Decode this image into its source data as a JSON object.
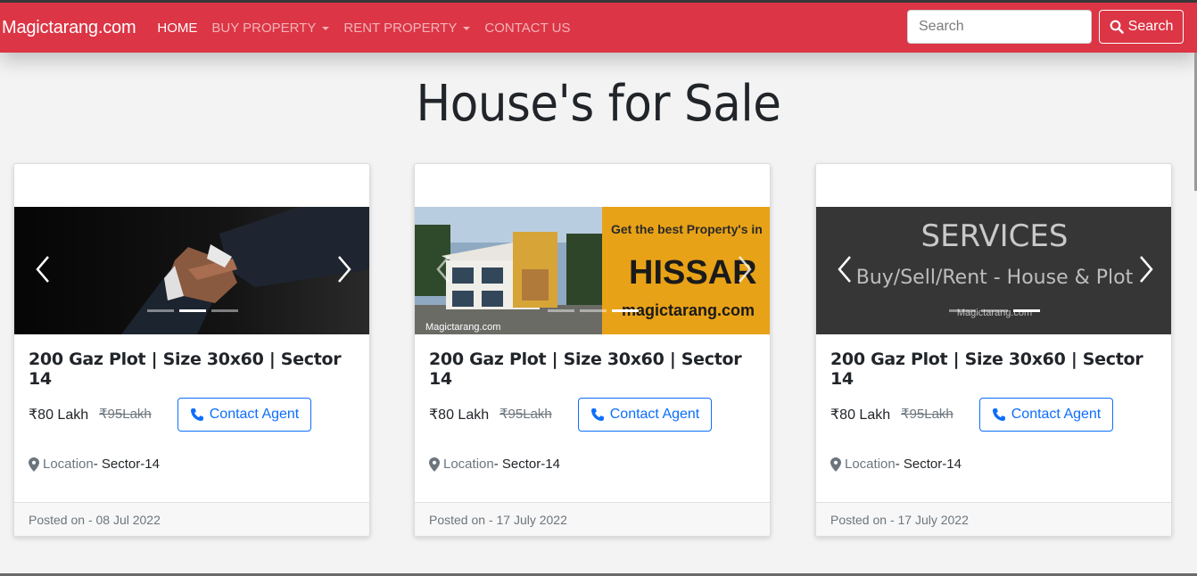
{
  "brand": "Magictarang.com",
  "nav": {
    "home": "HOME",
    "buy": "BUY PROPERTY",
    "rent": "RENT PROPERTY",
    "contact": "CONTACT US"
  },
  "search": {
    "placeholder": "Search",
    "button": "Search"
  },
  "heading": "House's for Sale",
  "colors": {
    "navbar": "#dc3545",
    "accent": "#0d6efd"
  },
  "slides": {
    "hissar": {
      "line1": "Get the best Property's in",
      "line2": "HISSAR",
      "line3": "magictarang.com",
      "watermark": "Magictarang.com"
    },
    "services": {
      "line1": "SERVICES",
      "line2": "Buy/Sell/Rent - House & Plot",
      "watermark": "Magictarang.com"
    }
  },
  "cards": [
    {
      "title": "200 Gaz Plot | Size 30x60 | Sector 14",
      "price": "₹80 Lakh",
      "old_price": "₹95Lakh",
      "contact": "Contact Agent",
      "location_label": "Location",
      "location_value": " - Sector-14",
      "posted": "Posted on - 08 Jul 2022"
    },
    {
      "title": "200 Gaz Plot | Size 30x60 | Sector 14",
      "price": "₹80 Lakh",
      "old_price": "₹95Lakh",
      "contact": "Contact Agent",
      "location_label": "Location",
      "location_value": " - Sector-14",
      "posted": "Posted on - 17 July 2022"
    },
    {
      "title": "200 Gaz Plot | Size 30x60 | Sector 14",
      "price": "₹80 Lakh",
      "old_price": "₹95Lakh",
      "contact": "Contact Agent",
      "location_label": "Location",
      "location_value": " - Sector-14",
      "posted": "Posted on - 17 July 2022"
    }
  ]
}
